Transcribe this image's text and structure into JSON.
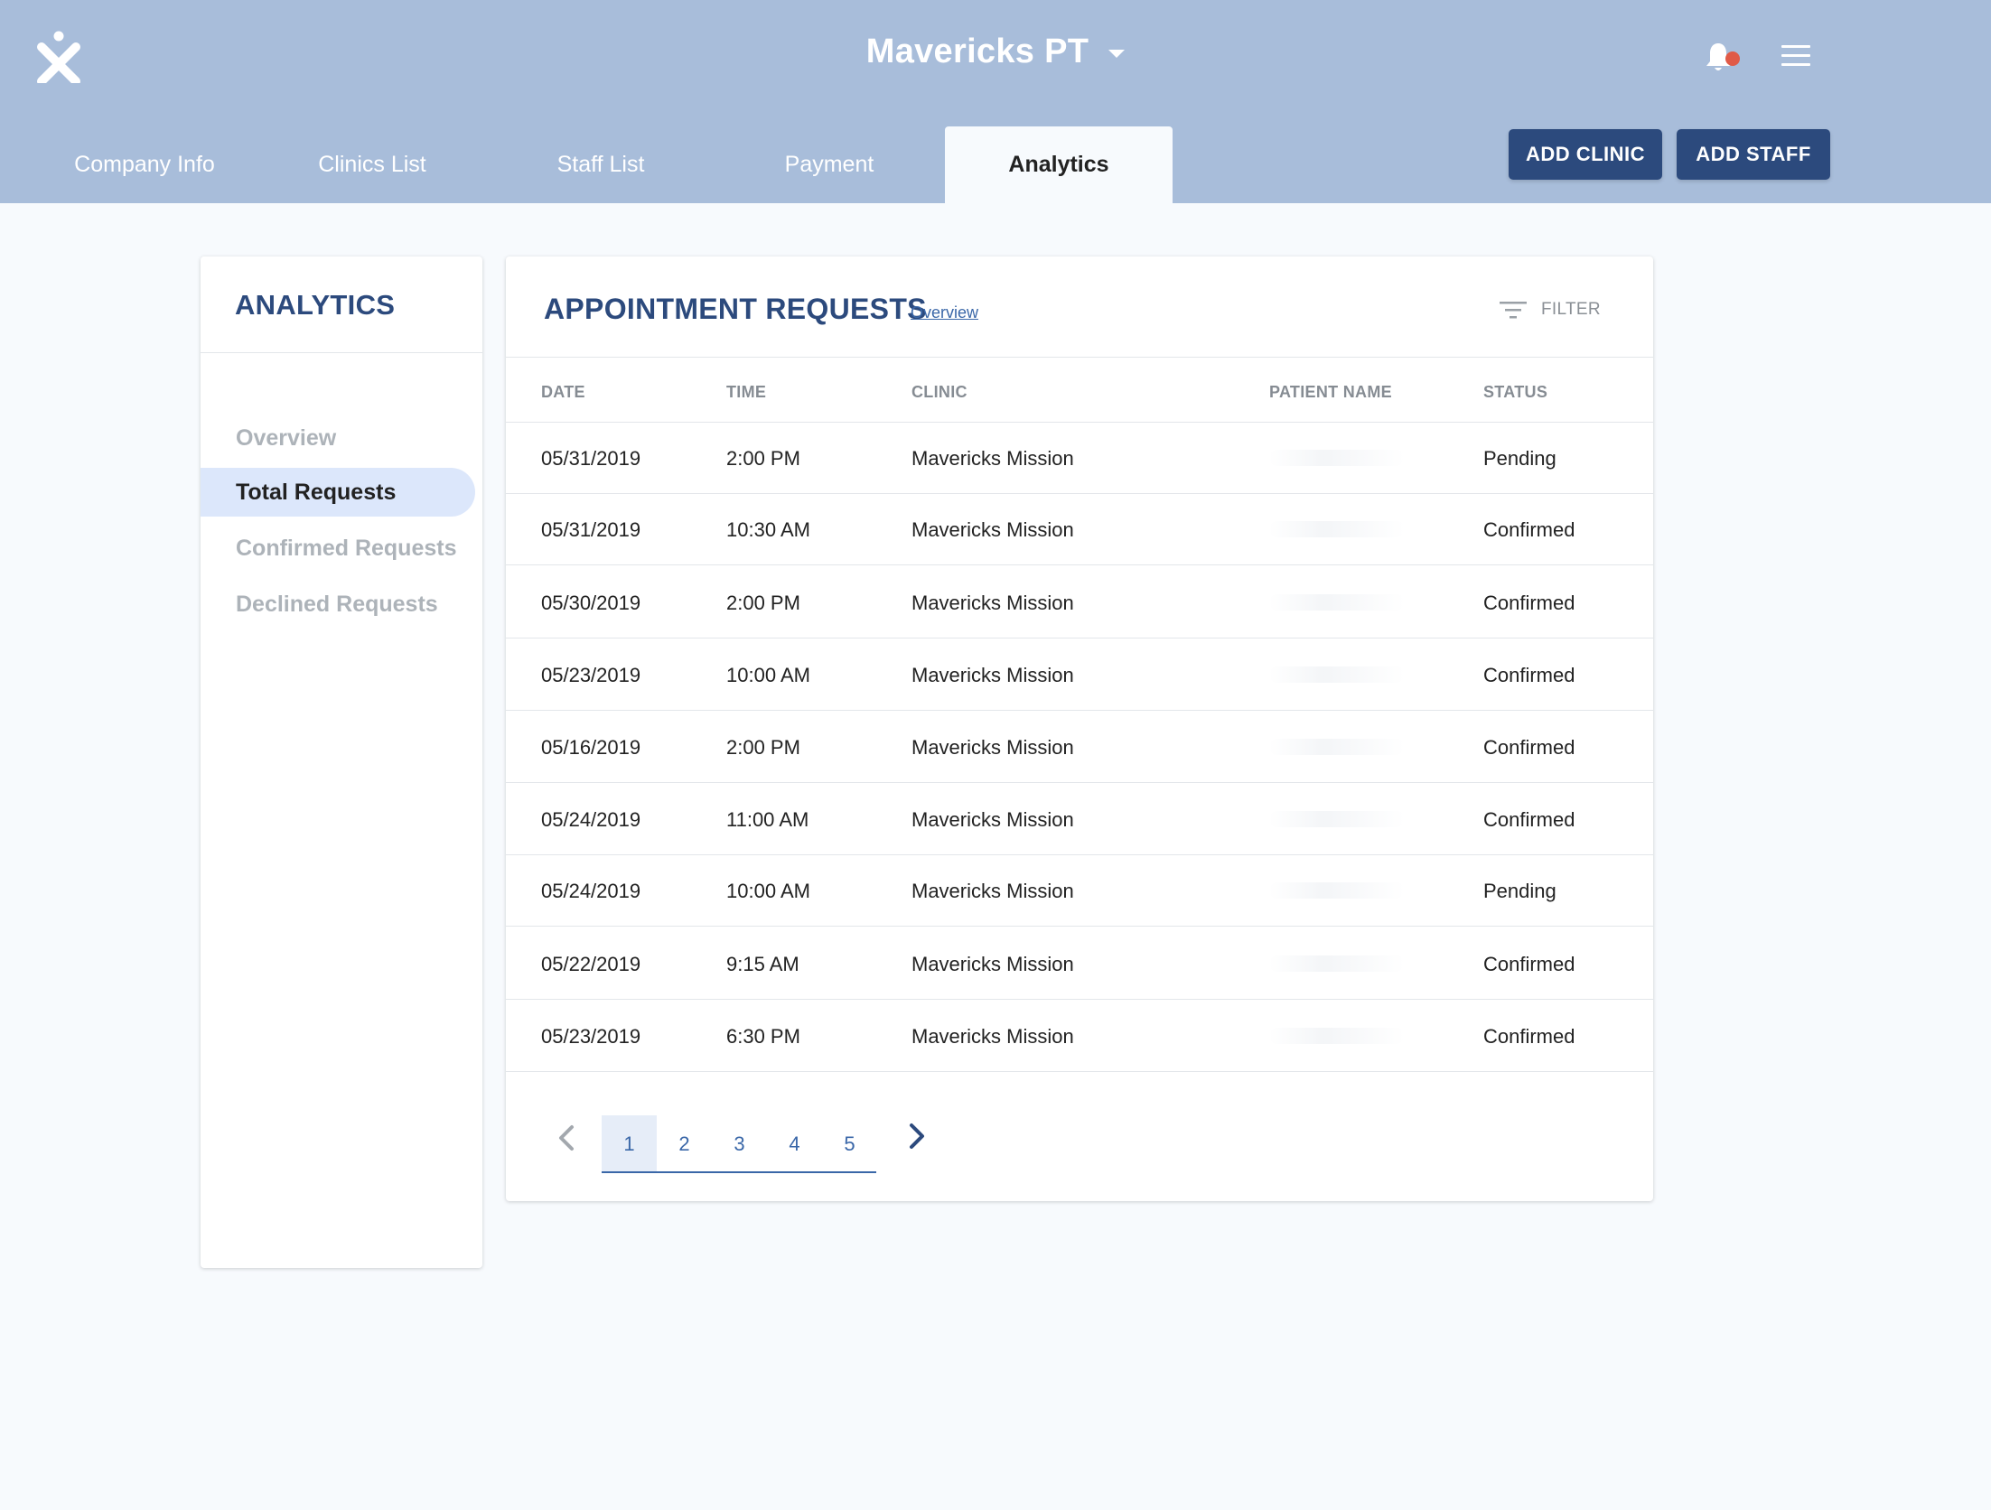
{
  "header": {
    "company_name": "Mavericks PT",
    "logo_icon": "x-person-logo-icon",
    "notification_icon": "bell-icon",
    "menu_icon": "hamburger-menu-icon",
    "colors": {
      "header_bg": "#a8bdda",
      "primary": "#2c4a7d",
      "alert_dot": "#e05a47"
    }
  },
  "tabs": [
    {
      "label": "Company Info"
    },
    {
      "label": "Clinics List"
    },
    {
      "label": "Staff List"
    },
    {
      "label": "Payment"
    },
    {
      "label": "Analytics"
    }
  ],
  "actions": {
    "add_clinic": "ADD CLINIC",
    "add_staff": "ADD STAFF"
  },
  "sidebar": {
    "title": "ANALYTICS",
    "items": [
      {
        "label": "Overview"
      },
      {
        "label": "Total Requests"
      },
      {
        "label": "Confirmed Requests"
      },
      {
        "label": "Declined Requests"
      }
    ]
  },
  "main": {
    "title": "APPOINTMENT REQUESTS",
    "overview_link": "Overview",
    "filter_label": "FILTER",
    "filter_icon": "filter-lines-icon",
    "columns": [
      "DATE",
      "TIME",
      "CLINIC",
      "PATIENT NAME",
      "STATUS"
    ],
    "rows": [
      {
        "date": "05/31/2019",
        "time": "2:00 PM",
        "clinic": "Mavericks Mission",
        "status": "Pending"
      },
      {
        "date": "05/31/2019",
        "time": "10:30 AM",
        "clinic": "Mavericks Mission",
        "status": "Confirmed"
      },
      {
        "date": "05/30/2019",
        "time": "2:00 PM",
        "clinic": "Mavericks Mission",
        "status": "Confirmed"
      },
      {
        "date": "05/23/2019",
        "time": "10:00 AM",
        "clinic": "Mavericks Mission",
        "status": "Confirmed"
      },
      {
        "date": "05/16/2019",
        "time": "2:00 PM",
        "clinic": "Mavericks Mission",
        "status": "Confirmed"
      },
      {
        "date": "05/24/2019",
        "time": "11:00 AM",
        "clinic": "Mavericks Mission",
        "status": "Confirmed"
      },
      {
        "date": "05/24/2019",
        "time": "10:00 AM",
        "clinic": "Mavericks Mission",
        "status": "Pending"
      },
      {
        "date": "05/22/2019",
        "time": "9:15 AM",
        "clinic": "Mavericks Mission",
        "status": "Confirmed"
      },
      {
        "date": "05/23/2019",
        "time": "6:30 PM",
        "clinic": "Mavericks Mission",
        "status": "Confirmed"
      }
    ],
    "pagination": {
      "prev_icon": "chevron-left-icon",
      "next_icon": "chevron-right-icon",
      "pages": [
        "1",
        "2",
        "3",
        "4",
        "5"
      ],
      "current": "1"
    }
  }
}
